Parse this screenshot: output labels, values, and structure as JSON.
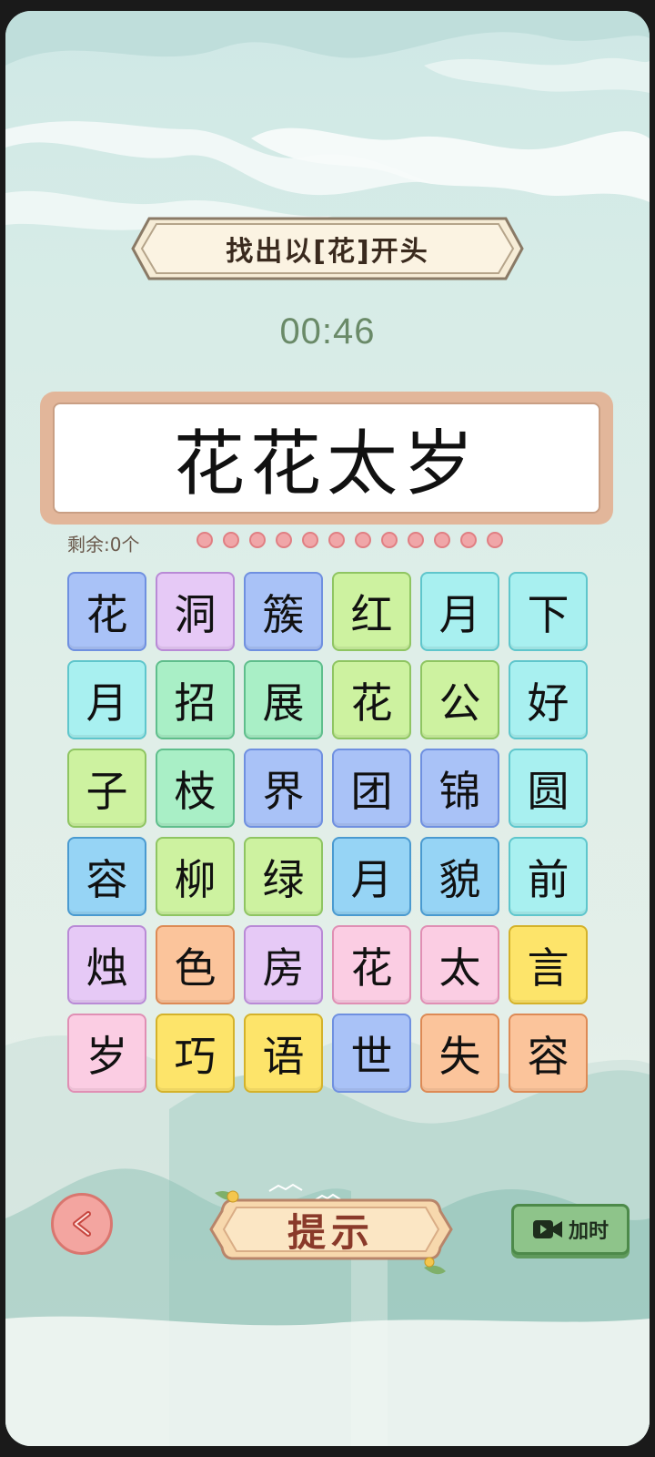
{
  "prompt": "找出以[花]开头",
  "timer": "00:46",
  "answer": "花花太岁",
  "remaining_label": "剩余:0个",
  "progress": {
    "total": 12,
    "remaining": 0
  },
  "colors": {
    "blue": {
      "bg": "#a9c2f7",
      "border": "#6f90e0"
    },
    "purple": {
      "bg": "#e6c9f6",
      "border": "#b98ad6"
    },
    "green": {
      "bg": "#cdf2a0",
      "border": "#8fc562"
    },
    "cyan": {
      "bg": "#a8f0f0",
      "border": "#5fc6cc"
    },
    "mint": {
      "bg": "#a9efc6",
      "border": "#5fbe8c"
    },
    "sky": {
      "bg": "#96d4f5",
      "border": "#4a9ad0"
    },
    "pink": {
      "bg": "#fbcde3",
      "border": "#e08fb4"
    },
    "orange": {
      "bg": "#fbc49b",
      "border": "#dd8a55"
    },
    "yellow": {
      "bg": "#fde46a",
      "border": "#d4b22a"
    }
  },
  "tiles": [
    {
      "char": "花",
      "color": "blue"
    },
    {
      "char": "洞",
      "color": "purple"
    },
    {
      "char": "簇",
      "color": "blue"
    },
    {
      "char": "红",
      "color": "green"
    },
    {
      "char": "月",
      "color": "cyan"
    },
    {
      "char": "下",
      "color": "cyan"
    },
    {
      "char": "月",
      "color": "cyan"
    },
    {
      "char": "招",
      "color": "mint"
    },
    {
      "char": "展",
      "color": "mint"
    },
    {
      "char": "花",
      "color": "green"
    },
    {
      "char": "公",
      "color": "green"
    },
    {
      "char": "好",
      "color": "cyan"
    },
    {
      "char": "子",
      "color": "green"
    },
    {
      "char": "枝",
      "color": "mint"
    },
    {
      "char": "界",
      "color": "blue"
    },
    {
      "char": "团",
      "color": "blue"
    },
    {
      "char": "锦",
      "color": "blue"
    },
    {
      "char": "圆",
      "color": "cyan"
    },
    {
      "char": "容",
      "color": "sky"
    },
    {
      "char": "柳",
      "color": "green"
    },
    {
      "char": "绿",
      "color": "green"
    },
    {
      "char": "月",
      "color": "sky"
    },
    {
      "char": "貌",
      "color": "sky"
    },
    {
      "char": "前",
      "color": "cyan"
    },
    {
      "char": "烛",
      "color": "purple"
    },
    {
      "char": "色",
      "color": "orange"
    },
    {
      "char": "房",
      "color": "purple"
    },
    {
      "char": "花",
      "color": "pink"
    },
    {
      "char": "太",
      "color": "pink"
    },
    {
      "char": "言",
      "color": "yellow"
    },
    {
      "char": "岁",
      "color": "pink"
    },
    {
      "char": "巧",
      "color": "yellow"
    },
    {
      "char": "语",
      "color": "yellow"
    },
    {
      "char": "世",
      "color": "blue"
    },
    {
      "char": "失",
      "color": "orange"
    },
    {
      "char": "容",
      "color": "orange"
    }
  ],
  "buttons": {
    "hint_label": "提示",
    "add_time_label": "加时",
    "back_icon": "back-arrow-icon",
    "video_icon": "video-camera-icon"
  }
}
